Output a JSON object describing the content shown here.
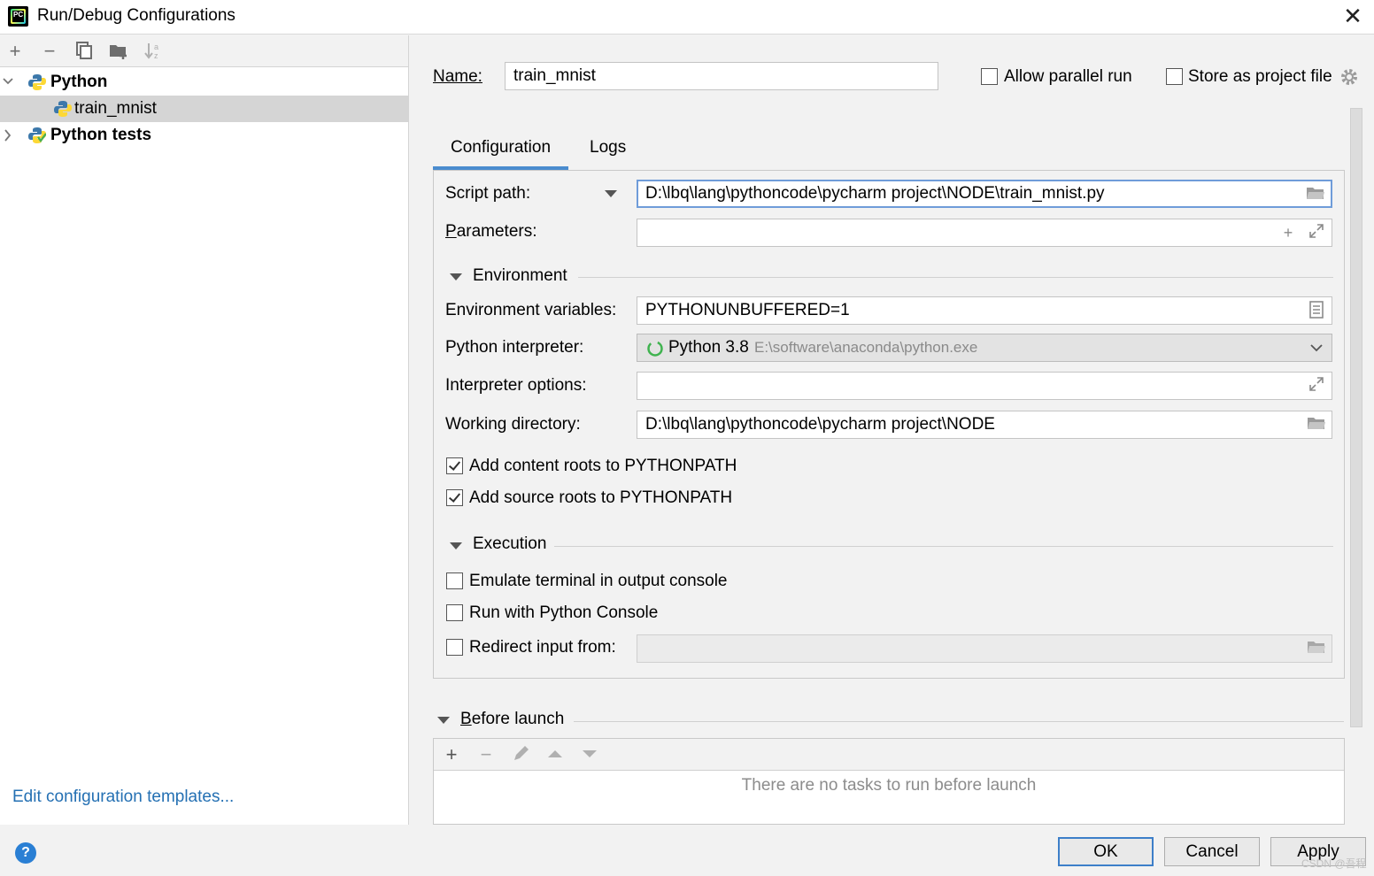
{
  "window": {
    "title": "Run/Debug Configurations",
    "close": "✕"
  },
  "left_toolbar": {
    "add": "+",
    "remove": "−",
    "copy": "⧉",
    "folder": "▰",
    "sort": "⇣"
  },
  "tree": [
    {
      "label": "Python",
      "expanded": true
    },
    {
      "label": "train_mnist",
      "selected": true
    },
    {
      "label": "Python tests",
      "expanded": false
    }
  ],
  "edit_templates": "Edit configuration templates...",
  "name": {
    "label": "Name:",
    "value": "train_mnist"
  },
  "allow_parallel": {
    "label": "Allow parallel run",
    "checked": false
  },
  "store_project": {
    "label": "Store as project file",
    "checked": false
  },
  "tabs": [
    {
      "label": "Configuration",
      "active": true
    },
    {
      "label": "Logs",
      "active": false
    }
  ],
  "script_path": {
    "label": "Script path:",
    "value": "D:\\lbq\\lang\\pythoncode\\pycharm project\\NODE\\train_mnist.py"
  },
  "parameters": {
    "label": "Parameters:",
    "value": ""
  },
  "environment": {
    "section": "Environment",
    "env_vars": {
      "label": "Environment variables:",
      "value": "PYTHONUNBUFFERED=1"
    },
    "interpreter": {
      "label": "Python interpreter:",
      "name": "Python 3.8",
      "path": "E:\\software\\anaconda\\python.exe"
    },
    "interp_options": {
      "label": "Interpreter options:",
      "value": ""
    },
    "working_dir": {
      "label": "Working directory:",
      "value": "D:\\lbq\\lang\\pythoncode\\pycharm project\\NODE"
    },
    "content_roots": {
      "label": "Add content roots to PYTHONPATH",
      "checked": true
    },
    "source_roots": {
      "label": "Add source roots to PYTHONPATH",
      "checked": true
    }
  },
  "execution": {
    "section": "Execution",
    "emulate_terminal": {
      "label": "Emulate terminal in output console",
      "checked": false
    },
    "python_console": {
      "label": "Run with Python Console",
      "checked": false
    },
    "redirect_input": {
      "label": "Redirect input from:",
      "checked": false,
      "value": ""
    }
  },
  "before_launch": {
    "section": "Before launch",
    "empty_text": "There are no tasks to run before launch"
  },
  "buttons": {
    "ok": "OK",
    "cancel": "Cancel",
    "apply": "Apply",
    "help": "?"
  },
  "watermark": "CSDN @吾程",
  "colors": {
    "accent": "#4a8ccf",
    "link": "#2470b3",
    "selection": "#d5d5d5"
  }
}
